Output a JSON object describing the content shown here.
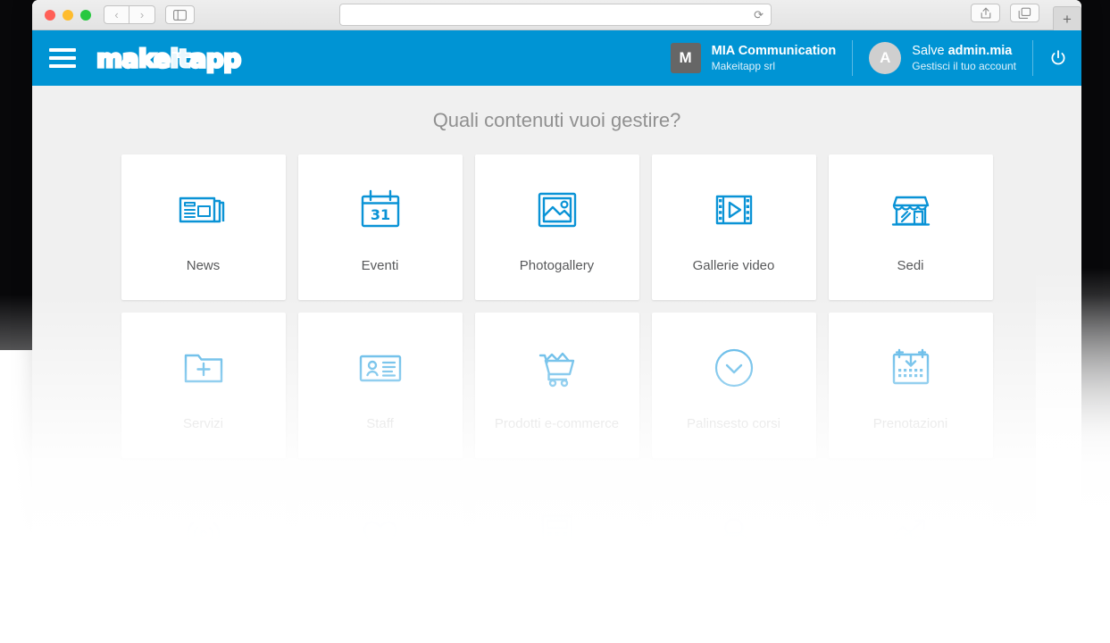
{
  "browser": {
    "traffic_lights": [
      "close",
      "minimize",
      "maximize"
    ],
    "back_label": "‹",
    "forward_label": "›",
    "sidebar_icon": "sidebar-icon",
    "url_value": "",
    "url_placeholder": "",
    "reload_label": "⟳",
    "share_icon": "share-icon",
    "tabs_icon": "tabs-icon",
    "new_tab_label": "+"
  },
  "header": {
    "menu_icon": "hamburger-menu-icon",
    "logo_part1": "make",
    "logo_part2": "it",
    "logo_part3": "app",
    "company": {
      "avatar_initial": "M",
      "name": "MIA Communication",
      "subtitle": "Makeitapp srl"
    },
    "user": {
      "avatar_initial": "A",
      "greeting_prefix": "Salve ",
      "greeting_name": "admin.mia",
      "subtitle": "Gestisci il tuo account"
    },
    "power_icon": "power-icon",
    "brand_color": "#0094d4"
  },
  "main": {
    "title": "Quali contenuti vuoi gestire?",
    "background_color": "#f0f0f0",
    "icon_color": "#0a93d6",
    "rows": [
      {
        "state": "active",
        "cards": [
          {
            "label": "News",
            "icon": "newspaper-icon"
          },
          {
            "label": "Eventi",
            "icon": "calendar-31-icon"
          },
          {
            "label": "Photogallery",
            "icon": "image-icon"
          },
          {
            "label": "Gallerie video",
            "icon": "film-play-icon"
          },
          {
            "label": "Sedi",
            "icon": "storefront-icon"
          }
        ]
      },
      {
        "state": "dimmed",
        "cards": [
          {
            "label": "Servizi",
            "icon": "folder-plus-icon"
          },
          {
            "label": "Staff",
            "icon": "id-card-icon"
          },
          {
            "label": "Prodotti e-commerce",
            "icon": "shopping-cart-icon"
          },
          {
            "label": "Palinsesto corsi",
            "icon": "clock-icon"
          },
          {
            "label": "Prenotazioni",
            "icon": "calendar-download-icon"
          }
        ]
      },
      {
        "state": "faded",
        "cards": [
          {
            "label": "",
            "icon": "beacon-signal-icon"
          },
          {
            "label": "",
            "icon": "heart-icon"
          },
          {
            "label": "",
            "icon": "calculator-icon"
          },
          {
            "label": "",
            "icon": "user-profile-icon"
          },
          {
            "label": "",
            "icon": "growth-chart-icon"
          }
        ]
      }
    ]
  }
}
